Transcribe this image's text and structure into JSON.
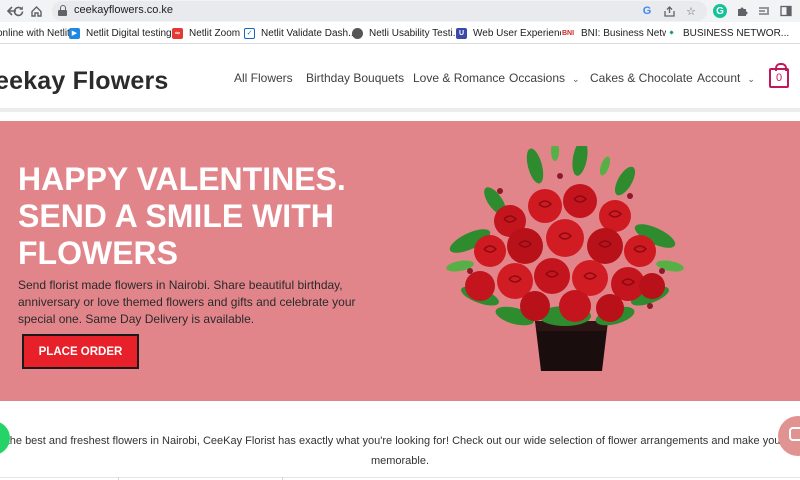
{
  "browser": {
    "url": "ceekayflowers.co.ke",
    "icons": [
      "back-icon",
      "reload-icon",
      "home-icon",
      "lock-icon",
      "google-icon",
      "share-icon",
      "bookmark-star-icon",
      "grammarly-icon",
      "extensions-icon",
      "reading-list-icon",
      "side-panel-icon"
    ]
  },
  "bookmarks": [
    {
      "label": "online with Netlit",
      "icon": "netlit-icon",
      "color": "#2b7de9"
    },
    {
      "label": "Netlit Digital testing",
      "icon": "netlit-icon",
      "color": "#1e88e5"
    },
    {
      "label": "Netlit Zoom",
      "icon": "zoom-icon",
      "color": "#e53935"
    },
    {
      "label": "Netlit Validate Dash...",
      "icon": "checkbox-icon",
      "color": "#1565c0"
    },
    {
      "label": "Netli Usability Testi...",
      "icon": "globe-icon",
      "color": "#555555"
    },
    {
      "label": "Web User Experience",
      "icon": "shield-icon",
      "color": "#3949ab"
    },
    {
      "label": "BNI: Business Netw...",
      "icon": "bni-icon",
      "color": "#c62828"
    },
    {
      "label": "BUSINESS NETWOR...",
      "icon": "network-icon",
      "color": "#00897b"
    }
  ],
  "site": {
    "brand": "eekay Flowers",
    "nav": [
      {
        "label": "All Flowers",
        "dropdown": false
      },
      {
        "label": "Birthday Bouquets",
        "dropdown": false
      },
      {
        "label": "Love & Romance",
        "dropdown": false
      },
      {
        "label": "Occasions",
        "dropdown": true
      },
      {
        "label": "Cakes & Chocolate",
        "dropdown": false
      },
      {
        "label": "Account",
        "dropdown": true
      }
    ],
    "cart_count": "0"
  },
  "hero": {
    "title_lines": [
      "HAPPY VALENTINES.",
      "SEND A SMILE WITH",
      "FLOWERS"
    ],
    "text": "Send florist made flowers in Nairobi. Share beautiful birthday, anniversary or love themed flowers and gifts and celebrate your special one. Same Day Delivery is available.",
    "cta": "PLACE ORDER",
    "background": "#e2858b",
    "cta_color": "#e8202a"
  },
  "intro": {
    "line1": "r the best and freshest flowers in Nairobi, CeeKay Florist has exactly what you're looking for! Check out our wide selection of flower arrangements and make your next mo",
    "line2": "memorable."
  },
  "widgets": {
    "left": "whatsapp-icon",
    "right": "chat-icon"
  }
}
